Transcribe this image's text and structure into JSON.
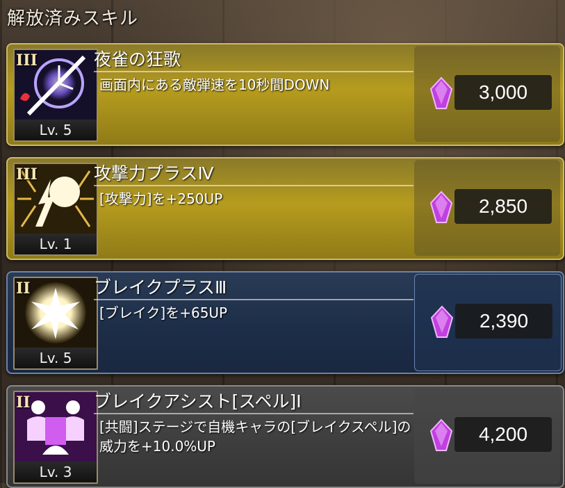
{
  "header": {
    "title": "解放済みスキル"
  },
  "skills": [
    {
      "rank": "III",
      "title": "夜雀の狂歌",
      "desc": "画面内にある敵弾速を10秒間DOWN",
      "level": "Lv. 5",
      "cost": "3,000",
      "style": "gold",
      "icon": "clock-slash-icon"
    },
    {
      "rank": "III",
      "title": "攻撃力プラスⅣ",
      "desc": "[攻撃力]を+250UP",
      "level": "Lv. 1",
      "cost": "2,850",
      "style": "gold",
      "icon": "impact-burst-icon"
    },
    {
      "rank": "II",
      "title": "ブレイクプラスⅢ",
      "desc": "[ブレイク]を+65UP",
      "level": "Lv. 5",
      "cost": "2,390",
      "style": "blue",
      "icon": "shatter-burst-icon"
    },
    {
      "rank": "II",
      "title": "ブレイクアシスト[スペル]Ⅰ",
      "desc": "[共闘]ステージで自機キャラの[ブレイクスペル]の威力を+10.0%UP",
      "level": "Lv. 3",
      "cost": "4,200",
      "style": "gray",
      "icon": "assist-figures-icon"
    }
  ],
  "colors": {
    "gem": "#c040e0",
    "gold_card": "#b69c1e",
    "blue_card": "#1c2d48",
    "gray_card": "#3d3d3d"
  }
}
